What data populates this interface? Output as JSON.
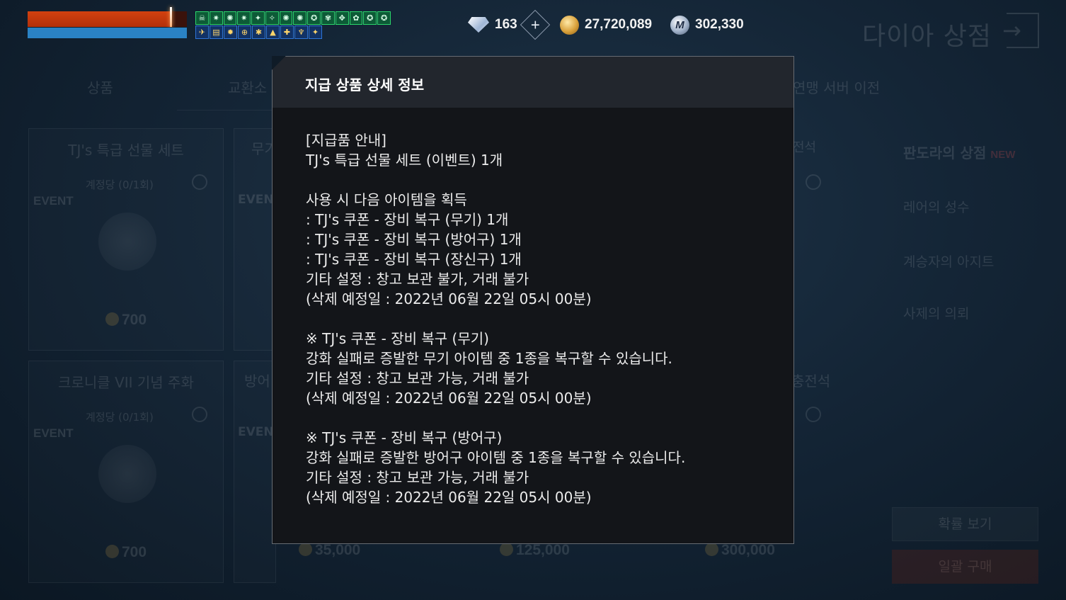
{
  "hud": {
    "hp_percent": 90,
    "mp_percent": 100,
    "buffs_row1": [
      "☠",
      "✷",
      "✺",
      "✷",
      "✦",
      "✧",
      "✺",
      "✺",
      "✪",
      "✾",
      "✥",
      "✿",
      "✪",
      "✪"
    ],
    "buffs_row2": [
      "✈",
      "▤",
      "✹",
      "⊕",
      "✱",
      "▲",
      "✚",
      "♆",
      "✦"
    ],
    "diamond_count": "163",
    "gold": "27,720,089",
    "mileage": "302,330",
    "mileage_icon_letter": "M",
    "plus_symbol": "+",
    "shop_title": "다이아 상점",
    "exit_arrow": "→"
  },
  "tabs": [
    "상품",
    "교환소",
    "연맹 서버 이전"
  ],
  "cards": [
    {
      "name": "TJ's 특급 선물 세트",
      "limit": "계정당 (0/1회)",
      "event": "EVENT",
      "price": "700"
    },
    {
      "name": "크로니클 VII 기념 주화",
      "limit": "계정당 (0/1회)",
      "event": "EVENT",
      "price": "700"
    }
  ],
  "partials": {
    "card2_top_name": "무기",
    "card2_bottom_name": "방어",
    "card2_event_top": "EVEN",
    "card2_event_bottom": "EVEN",
    "card4_top_name": "전석",
    "card4_bottom_name": "충전석"
  },
  "bottom_prices": [
    "35,000",
    "125,000",
    "300,000"
  ],
  "side_menu": {
    "title": "판도라의 상점",
    "new_badge": "NEW",
    "items": [
      "레어의 성수",
      "계승자의 아지트",
      "사제의 의뢰"
    ]
  },
  "buttons": {
    "probability": "확률 보기",
    "bulk_buy": "일괄 구매"
  },
  "modal": {
    "title": "지급 상품 상세 정보",
    "lines": [
      "[지급품 안내]",
      "TJ's 특급 선물 세트 (이벤트) 1개",
      "",
      "사용 시 다음 아이템을 획득",
      ": TJ's 쿠폰 - 장비 복구 (무기) 1개",
      ": TJ's 쿠폰 - 장비 복구 (방어구) 1개",
      ": TJ's 쿠폰 - 장비 복구 (장신구) 1개",
      "기타 설정 : 창고 보관 불가, 거래 불가",
      "(삭제 예정일 : 2022년 06월 22일 05시 00분)",
      "",
      "※ TJ's 쿠폰 - 장비 복구 (무기)",
      "강화 실패로 증발한 무기 아이템 중 1종을 복구할 수 있습니다.",
      "기타 설정 : 창고 보관 가능, 거래 불가",
      "(삭제 예정일 : 2022년 06월 22일 05시 00분)",
      "",
      "※ TJ's 쿠폰 - 장비 복구 (방어구)",
      "강화 실패로 증발한 방어구 아이템 중 1종을 복구할 수 있습니다.",
      "기타 설정 : 창고 보관 가능, 거래 불가",
      "(삭제 예정일 : 2022년 06월 22일 05시 00분)"
    ]
  }
}
